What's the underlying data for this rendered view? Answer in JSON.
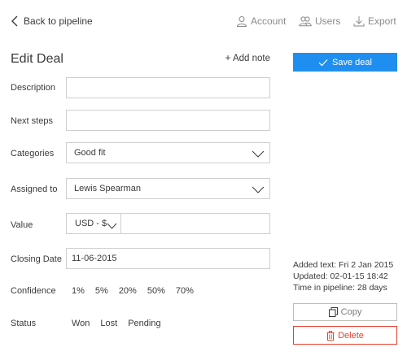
{
  "header": {
    "back_label": "Back to pipeline",
    "nav": [
      {
        "label": "Account",
        "icon": "user-icon"
      },
      {
        "label": "Users",
        "icon": "users-icon"
      },
      {
        "label": "Export",
        "icon": "download-icon"
      }
    ]
  },
  "form": {
    "title": "Edit Deal",
    "add_note": "+ Add note",
    "description": {
      "label": "Description",
      "value": ""
    },
    "next_steps": {
      "label": "Next steps",
      "value": ""
    },
    "categories": {
      "label": "Categories",
      "value": "Good fit"
    },
    "assigned_to": {
      "label": "Assigned to",
      "value": "Lewis Spearman"
    },
    "value": {
      "label": "Value",
      "currency": "USD - $",
      "amount": ""
    },
    "closing_date": {
      "label": "Closing Date",
      "value": "11-06-2015"
    },
    "confidence": {
      "label": "Confidence",
      "options": [
        "1%",
        "5%",
        "20%",
        "50%",
        "70%"
      ]
    },
    "status": {
      "label": "Status",
      "options": [
        "Won",
        "Lost",
        "Pending"
      ]
    }
  },
  "sidebar": {
    "save_label": "Save deal",
    "added_text": "Added text: Fri 2 Jan 2015",
    "updated_text": "Updated: 02-01-15 18:42",
    "time_text": "Time in pipeline: 28 days",
    "copy_label": "Copy",
    "delete_label": "Delete"
  },
  "colors": {
    "accent": "#1e8ff0",
    "danger": "#e8412f",
    "border": "#cfcfcf"
  }
}
